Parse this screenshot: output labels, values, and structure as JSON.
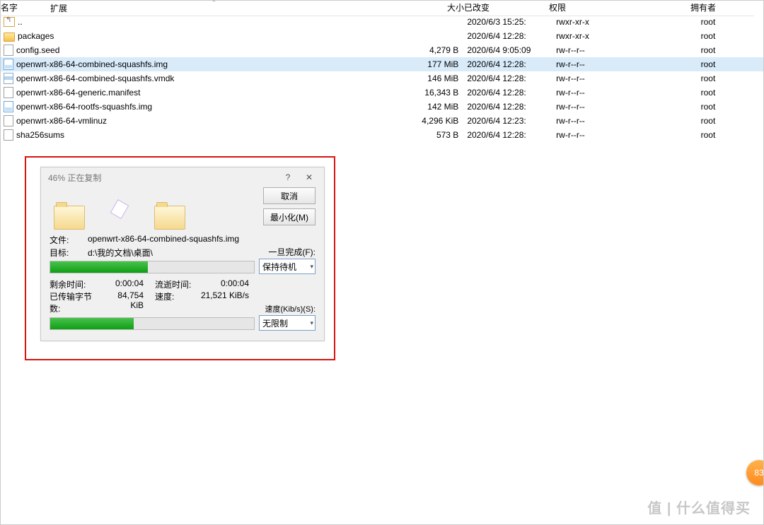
{
  "columns": {
    "name": "名字",
    "ext": "扩展",
    "size": "大小",
    "changed": "已改变",
    "perm": "权限",
    "owner": "拥有者"
  },
  "files": [
    {
      "icon": "up",
      "name": "..",
      "size": "",
      "date": "2020/6/3 15:25:",
      "perm": "rwxr-xr-x",
      "owner": "root"
    },
    {
      "icon": "folder",
      "name": "packages",
      "size": "",
      "date": "2020/6/4 12:28:",
      "perm": "rwxr-xr-x",
      "owner": "root"
    },
    {
      "icon": "file",
      "name": "config.seed",
      "size": "4,279 B",
      "date": "2020/6/4 9:05:09",
      "perm": "rw-r--r--",
      "owner": "root"
    },
    {
      "icon": "img",
      "name": "openwrt-x86-64-combined-squashfs.img",
      "size": "177 MiB",
      "date": "2020/6/4 12:28:",
      "perm": "rw-r--r--",
      "owner": "root",
      "selected": true
    },
    {
      "icon": "vmdk",
      "name": "openwrt-x86-64-combined-squashfs.vmdk",
      "size": "146 MiB",
      "date": "2020/6/4 12:28:",
      "perm": "rw-r--r--",
      "owner": "root"
    },
    {
      "icon": "file",
      "name": "openwrt-x86-64-generic.manifest",
      "size": "16,343 B",
      "date": "2020/6/4 12:28:",
      "perm": "rw-r--r--",
      "owner": "root"
    },
    {
      "icon": "img",
      "name": "openwrt-x86-64-rootfs-squashfs.img",
      "size": "142 MiB",
      "date": "2020/6/4 12:28:",
      "perm": "rw-r--r--",
      "owner": "root"
    },
    {
      "icon": "file",
      "name": "openwrt-x86-64-vmlinuz",
      "size": "4,296 KiB",
      "date": "2020/6/4 12:23:",
      "perm": "rw-r--r--",
      "owner": "root"
    },
    {
      "icon": "file",
      "name": "sha256sums",
      "size": "573 B",
      "date": "2020/6/4 12:28:",
      "perm": "rw-r--r--",
      "owner": "root"
    }
  ],
  "dialog": {
    "title": "46% 正在复制",
    "help": "?",
    "cancel": "取消",
    "minimize": "最小化(M)",
    "file_label": "文件:",
    "file_value": "openwrt-x86-64-combined-squashfs.img",
    "target_label": "目标:",
    "target_value": "d:\\我的文档\\桌面\\",
    "once_done": "一旦完成(F):",
    "once_done_value": "保持待机",
    "time_left_label": "剩余时间:",
    "time_left_value": "0:00:04",
    "elapsed_label": "流逝时间:",
    "elapsed_value": "0:00:04",
    "bytes_label": "已传输字节数:",
    "bytes_value": "84,754 KiB",
    "speed_label": "速度:",
    "speed_value": "21,521 KiB/s",
    "speed_limit_label": "速度(Kib/s)(S):",
    "speed_limit_value": "无限制",
    "progress1": 48,
    "progress2": 41
  },
  "watermark": "值 | 什么值得买",
  "badge": "83"
}
